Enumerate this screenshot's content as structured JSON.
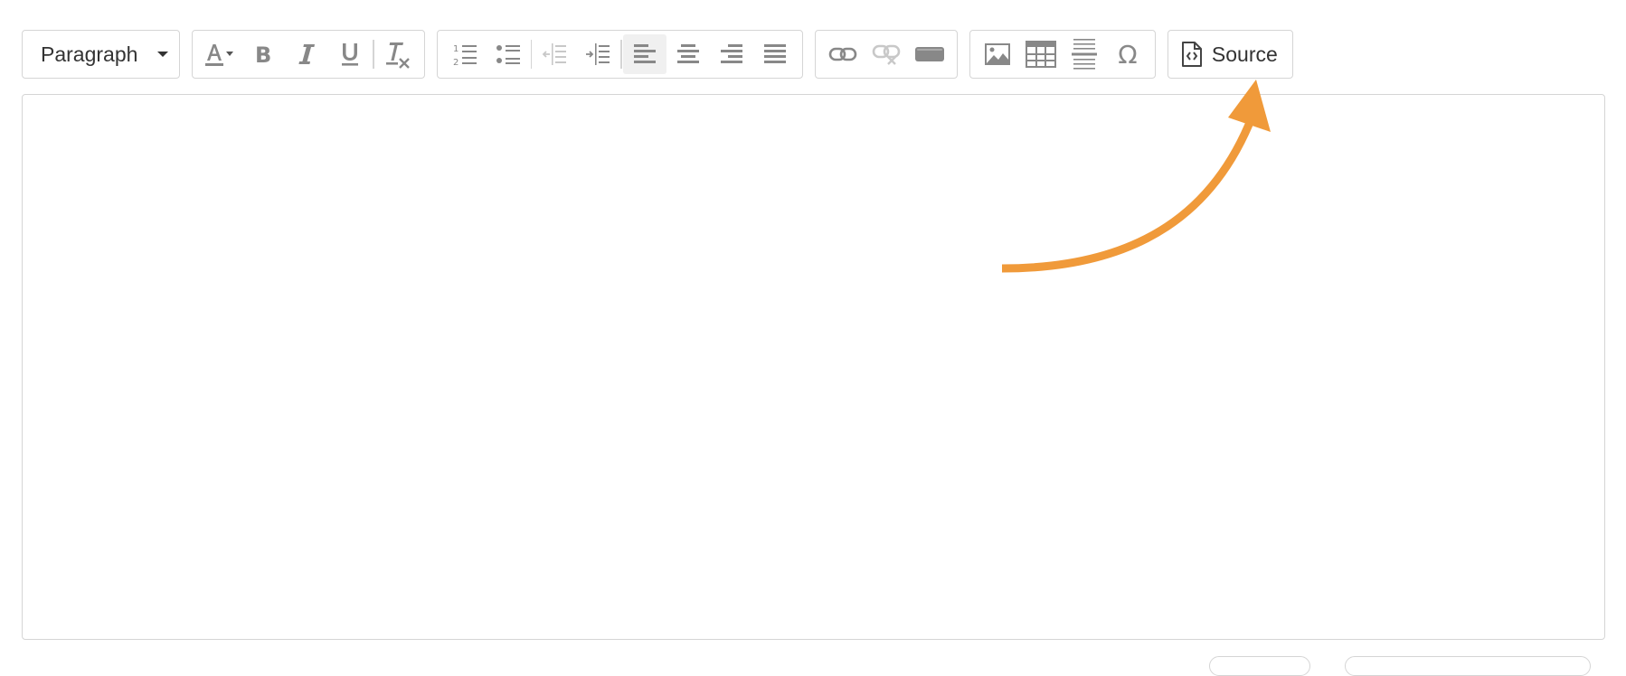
{
  "toolbar": {
    "format": {
      "selected": "Paragraph",
      "icon": "chevron-down-icon"
    },
    "text_group": [
      "text-color-icon",
      "bold-icon",
      "italic-icon",
      "underline-icon",
      "clear-formatting-icon"
    ],
    "list_align_group": [
      "numbered-list-icon",
      "bulleted-list-icon",
      "outdent-icon",
      "indent-icon",
      "align-left-icon",
      "align-center-icon",
      "align-right-icon",
      "align-justify-icon"
    ],
    "active_alignment": "align-left",
    "insert_group": [
      "link-icon",
      "unlink-icon",
      "button-icon"
    ],
    "media_group": [
      "image-icon",
      "table-icon",
      "horizontal-rule-icon",
      "special-character-icon"
    ],
    "source": {
      "label": "Source",
      "icon": "source-code-icon"
    }
  },
  "editor": {
    "content": ""
  },
  "annotation": {
    "type": "arrow",
    "color": "#f09a3a",
    "points_to": "source-button"
  },
  "colors": {
    "icon": "#888888",
    "icon_disabled": "#c8c8c8",
    "border": "#d5d5d5",
    "accent": "#f09a3a"
  }
}
